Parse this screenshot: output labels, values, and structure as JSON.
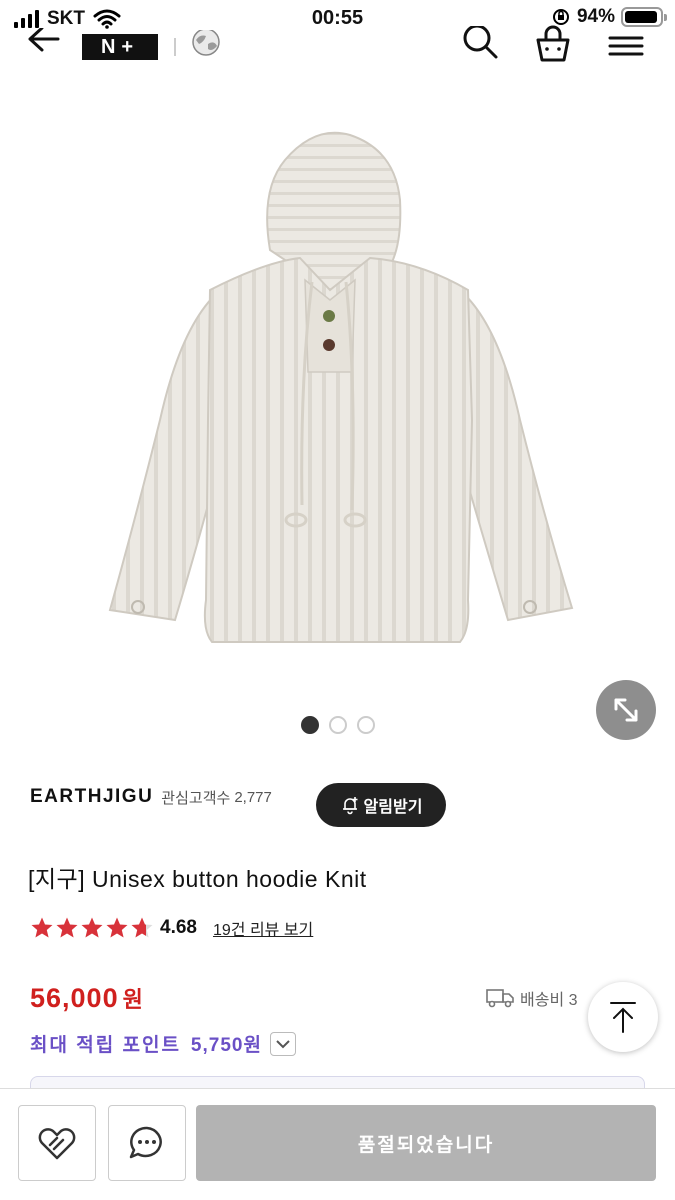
{
  "status_bar": {
    "carrier": "SKT",
    "time": "00:55",
    "battery_percent": "94%",
    "battery_level": 0.94,
    "icons": [
      "signal-icon",
      "wifi-icon",
      "orientation-lock-icon",
      "battery-icon"
    ]
  },
  "header": {
    "logo_text": "N+",
    "icons": [
      "back-arrow-icon",
      "globe-icon",
      "search-icon",
      "shopping-bag-icon",
      "hamburger-menu-icon"
    ]
  },
  "gallery": {
    "image_count": 3,
    "active_index": 0,
    "image_icon": "knit-hoodie-image",
    "expand_icon": "expand-arrows-icon"
  },
  "brand": {
    "name": "EARTHJIGU",
    "follower_label": "관심고객수",
    "follower_count": "2,777",
    "alarm_label": "알림받기"
  },
  "product": {
    "title": "[지구] Unisex button hoodie Knit",
    "rating": "4.68",
    "rating_stars": 4.68,
    "review_link": "19건 리뷰 보기",
    "price": "56,000",
    "price_unit": "원",
    "shipping_text": "배송비 3",
    "points_text": "최대 적립 포인트",
    "points_value": "5,750원"
  },
  "bottom_bar": {
    "soldout_label": "품절되었습니다",
    "wish_icon": "heart-icon",
    "chat_icon": "chat-bubble-icon"
  },
  "colors": {
    "price": "#d0201e",
    "points": "#6a50c6",
    "star": "#d8323a",
    "soldout_bg": "#b3b3b3",
    "alarm_bg": "#222222"
  }
}
